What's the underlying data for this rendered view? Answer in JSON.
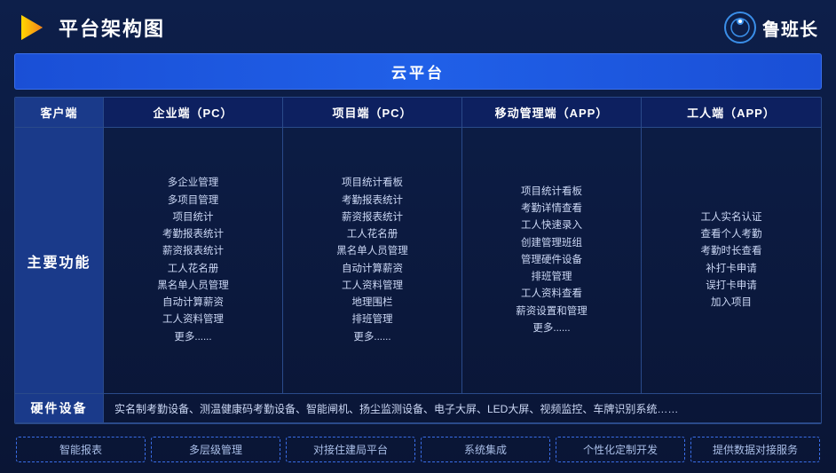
{
  "header": {
    "title": "平台架构图",
    "brand_name": "鲁班长"
  },
  "cloud_banner": "云平台",
  "col_headers": {
    "client": "客户端",
    "enterprise": "企业端（PC）",
    "project": "项目端（PC）",
    "mobile": "移动管理端（APP）",
    "worker": "工人端（APP）"
  },
  "main_section_label": "主要功能",
  "enterprise_features": [
    "多企业管理",
    "多项目管理",
    "项目统计",
    "考勤报表统计",
    "薪资报表统计",
    "工人花名册",
    "黑名单人员管理",
    "自动计算薪资",
    "工人资料管理",
    "更多......"
  ],
  "project_features": [
    "项目统计看板",
    "考勤报表统计",
    "薪资报表统计",
    "工人花名册",
    "黑名单人员管理",
    "自动计算薪资",
    "工人资料管理",
    "地理围栏",
    "排班管理",
    "更多......"
  ],
  "mobile_features": [
    "项目统计看板",
    "考勤详情查看",
    "工人快速录入",
    "创建管理班组",
    "管理硬件设备",
    "排班管理",
    "工人资料查看",
    "薪资设置和管理",
    "更多......"
  ],
  "worker_features": [
    "工人实名认证",
    "查看个人考勤",
    "考勤时长查看",
    "补打卡申请",
    "误打卡申请",
    "加入项目"
  ],
  "hardware_label": "硬件设备",
  "hardware_content": "实名制考勤设备、测温健康码考勤设备、智能闸机、扬尘监测设备、电子大屏、LED大屏、视频监控、车牌识别系统……",
  "tags": [
    "智能报表",
    "多层级管理",
    "对接住建局平台",
    "系统集成",
    "个性化定制开发",
    "提供数据对接服务"
  ]
}
